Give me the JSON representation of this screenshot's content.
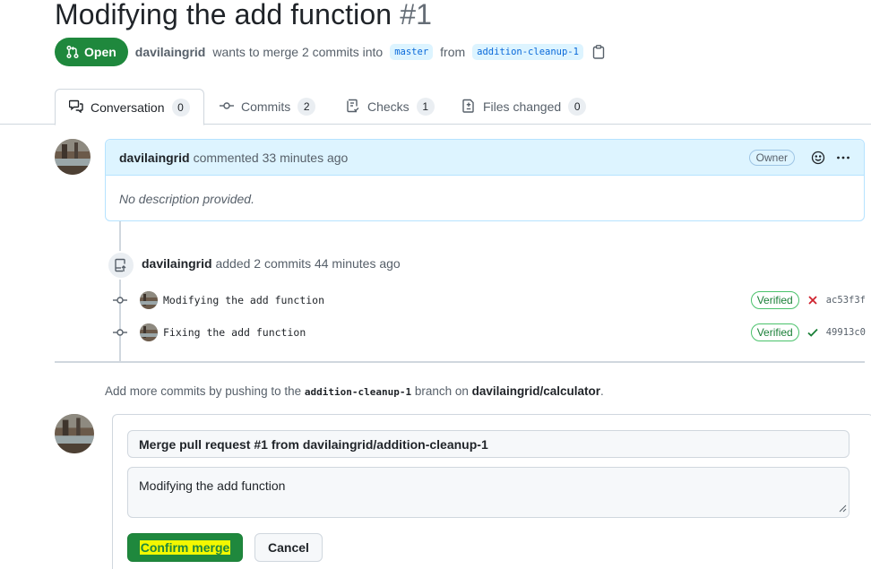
{
  "pr": {
    "title": "Modifying the add function",
    "number": "#1",
    "state": "Open",
    "author": "davilaingrid",
    "merge_text": "wants to merge 2 commits into",
    "base_branch": "master",
    "from_text": "from",
    "head_branch": "addition-cleanup-1"
  },
  "tabs": [
    {
      "label": "Conversation",
      "count": "0",
      "icon": "comment-discussion-icon"
    },
    {
      "label": "Commits",
      "count": "2",
      "icon": "git-commit-icon"
    },
    {
      "label": "Checks",
      "count": "1",
      "icon": "checklist-icon"
    },
    {
      "label": "Files changed",
      "count": "0",
      "icon": "file-diff-icon"
    }
  ],
  "comment": {
    "author": "davilaingrid",
    "action": "commented 33 minutes ago",
    "badge": "Owner",
    "body": "No description provided."
  },
  "push_event": {
    "author": "davilaingrid",
    "text": "added 2 commits 44 minutes ago"
  },
  "commits": [
    {
      "message": "Modifying the add function",
      "verified": "Verified",
      "status": "failure",
      "sha": "ac53f3f"
    },
    {
      "message": "Fixing the add function",
      "verified": "Verified",
      "status": "success",
      "sha": "49913c0"
    }
  ],
  "hint": {
    "prefix": "Add more commits by pushing to the",
    "branch": "addition-cleanup-1",
    "middle": "branch on",
    "repo": "davilaingrid/calculator",
    "suffix": "."
  },
  "merge": {
    "title_value": "Merge pull request #1 from davilaingrid/addition-cleanup-1",
    "body_value": "Modifying the add function",
    "confirm_label": "Confirm merge",
    "cancel_label": "Cancel"
  },
  "colors": {
    "open_green": "#1f883d",
    "failure_red": "#cf222e",
    "success_green": "#1a7f37",
    "highlight": "#f3f700"
  }
}
